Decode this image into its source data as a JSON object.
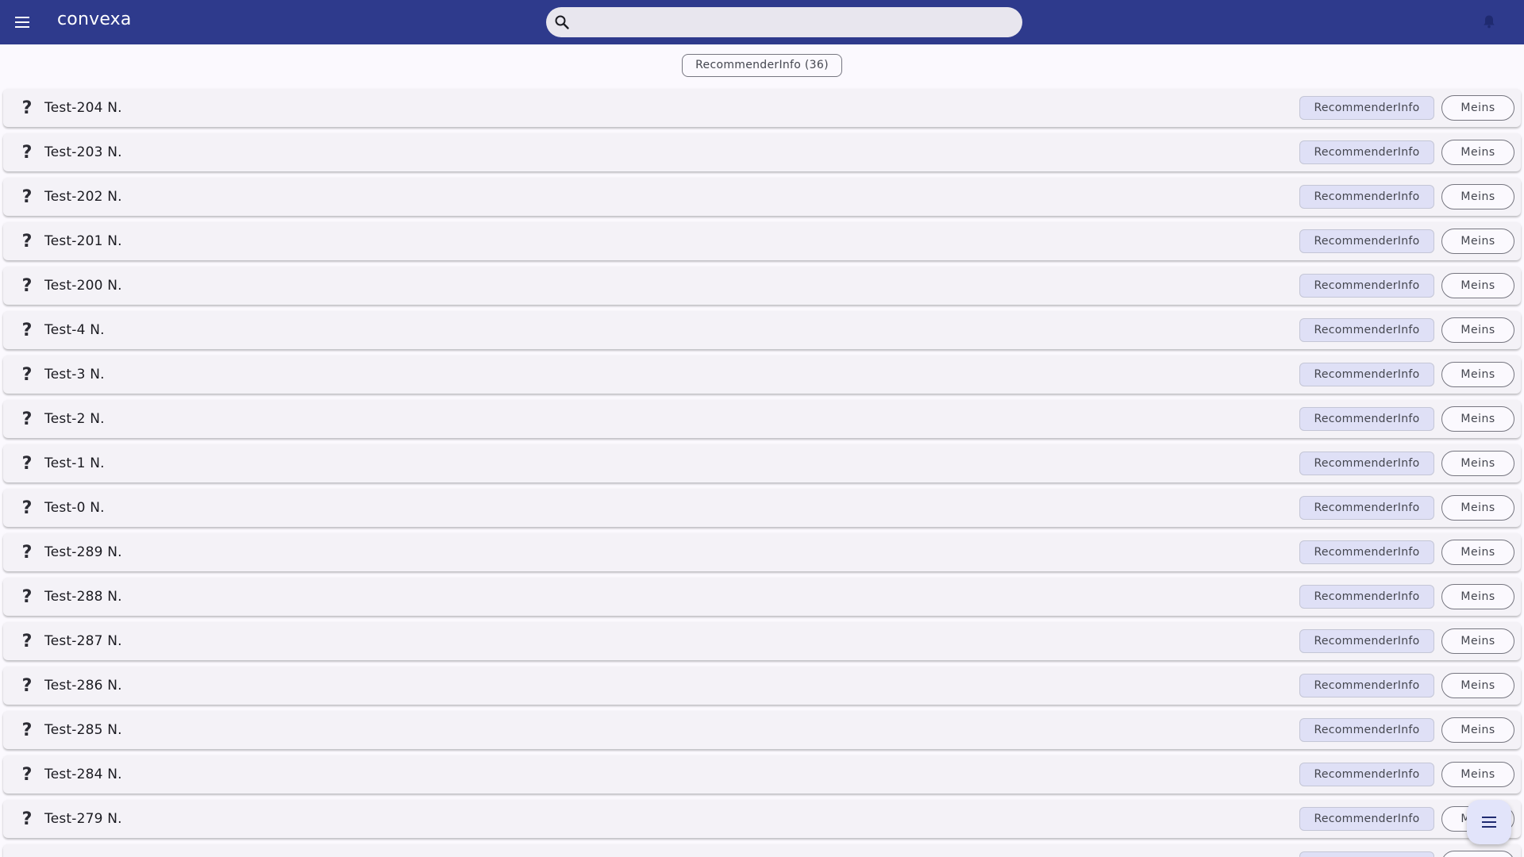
{
  "header": {
    "title": "convexa",
    "menu_icon": "menu-icon",
    "search": {
      "placeholder": "",
      "value": "",
      "icon": "search-icon"
    },
    "notifications_icon": "bell-icon"
  },
  "filter": {
    "label": "RecommenderInfo (36)"
  },
  "rows": [
    {
      "icon": "?",
      "name": "Test-204 N.",
      "tag": "RecommenderInfo",
      "action": "Meins"
    },
    {
      "icon": "?",
      "name": "Test-203 N.",
      "tag": "RecommenderInfo",
      "action": "Meins"
    },
    {
      "icon": "?",
      "name": "Test-202 N.",
      "tag": "RecommenderInfo",
      "action": "Meins"
    },
    {
      "icon": "?",
      "name": "Test-201 N.",
      "tag": "RecommenderInfo",
      "action": "Meins"
    },
    {
      "icon": "?",
      "name": "Test-200 N.",
      "tag": "RecommenderInfo",
      "action": "Meins"
    },
    {
      "icon": "?",
      "name": "Test-4 N.",
      "tag": "RecommenderInfo",
      "action": "Meins"
    },
    {
      "icon": "?",
      "name": "Test-3 N.",
      "tag": "RecommenderInfo",
      "action": "Meins"
    },
    {
      "icon": "?",
      "name": "Test-2 N.",
      "tag": "RecommenderInfo",
      "action": "Meins"
    },
    {
      "icon": "?",
      "name": "Test-1 N.",
      "tag": "RecommenderInfo",
      "action": "Meins"
    },
    {
      "icon": "?",
      "name": "Test-0 N.",
      "tag": "RecommenderInfo",
      "action": "Meins"
    },
    {
      "icon": "?",
      "name": "Test-289 N.",
      "tag": "RecommenderInfo",
      "action": "Meins"
    },
    {
      "icon": "?",
      "name": "Test-288 N.",
      "tag": "RecommenderInfo",
      "action": "Meins"
    },
    {
      "icon": "?",
      "name": "Test-287 N.",
      "tag": "RecommenderInfo",
      "action": "Meins"
    },
    {
      "icon": "?",
      "name": "Test-286 N.",
      "tag": "RecommenderInfo",
      "action": "Meins"
    },
    {
      "icon": "?",
      "name": "Test-285 N.",
      "tag": "RecommenderInfo",
      "action": "Meins"
    },
    {
      "icon": "?",
      "name": "Test-284 N.",
      "tag": "RecommenderInfo",
      "action": "Meins"
    },
    {
      "icon": "?",
      "name": "Test-279 N.",
      "tag": "RecommenderInfo",
      "action": "Meins"
    },
    {
      "icon": "",
      "name": "",
      "tag": "",
      "action": ""
    }
  ],
  "fab": {
    "icon": "menu-icon"
  },
  "colors": {
    "topbar": "#2e3a8c",
    "background": "#fbf9fe",
    "row": "#f4f2f7",
    "tag": "#dfe0f6",
    "fab": "#e2e4fa"
  }
}
